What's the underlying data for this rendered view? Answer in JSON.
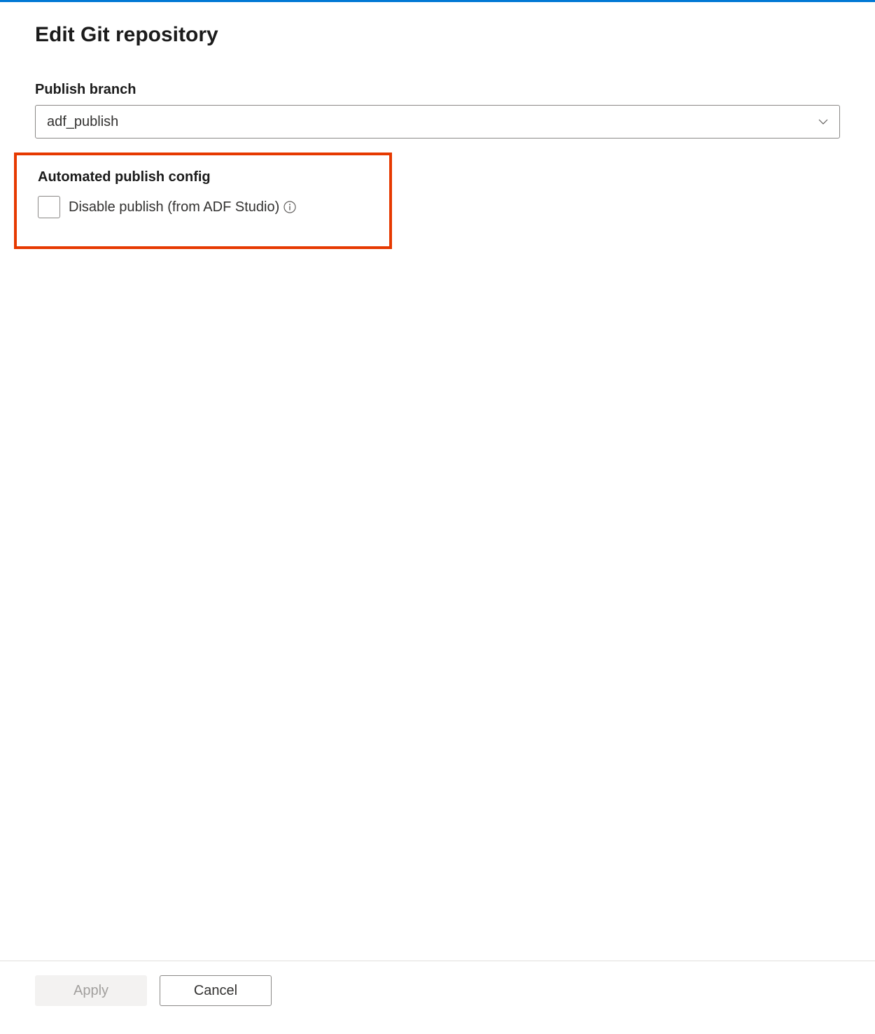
{
  "page": {
    "title": "Edit Git repository"
  },
  "publishBranch": {
    "label": "Publish branch",
    "value": "adf_publish"
  },
  "automatedPublish": {
    "sectionLabel": "Automated publish config",
    "checkboxLabel": "Disable publish (from ADF Studio)",
    "checked": false
  },
  "footer": {
    "apply": "Apply",
    "cancel": "Cancel"
  }
}
